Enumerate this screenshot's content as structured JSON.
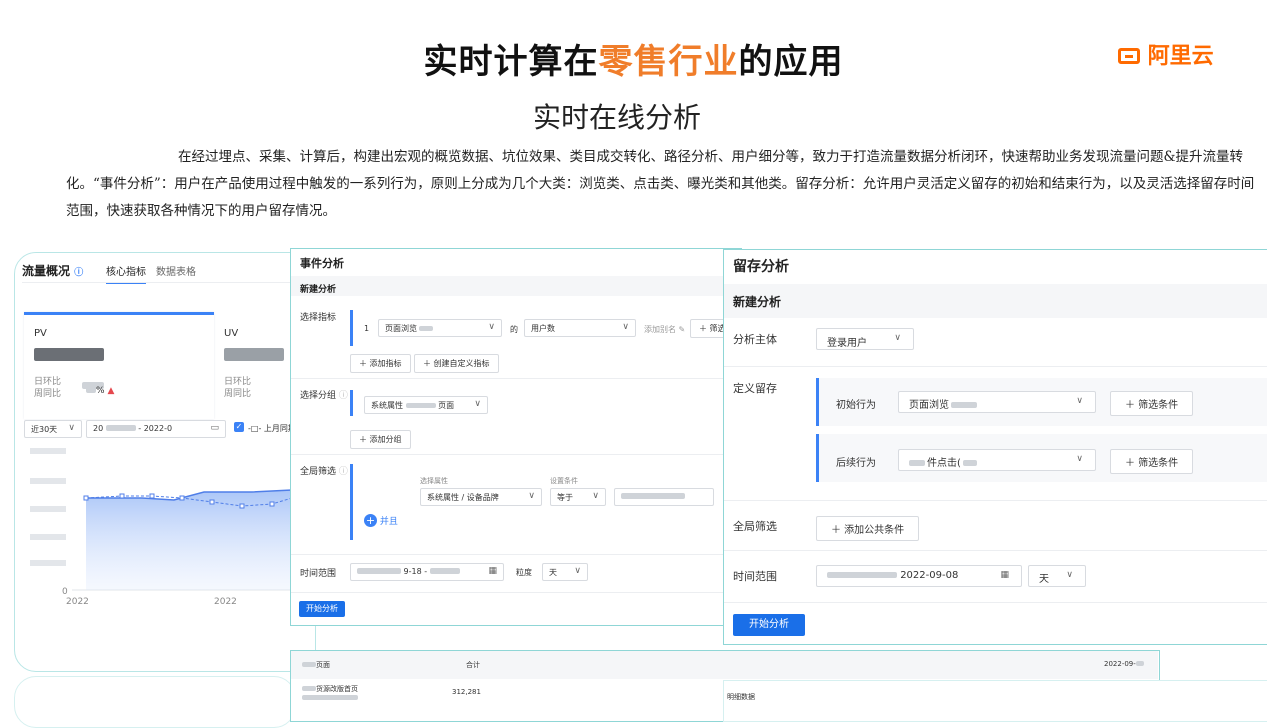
{
  "header": {
    "title_before": "实时计算在",
    "title_highlight": "零售行业",
    "title_after": "的应用",
    "logo_text": "阿里云",
    "subtitle": "实时在线分析",
    "description": "在经过埋点、采集、计算后，构建出宏观的概览数据、坑位效果、类目成交转化、路径分析、用户细分等，致力于打造流量数据分析闭环，快速帮助业务发现流量问题&提升流量转化。“事件分析”：用户在产品使用过程中触发的一系列行为，原则上分成为几个大类：浏览类、点击类、曝光类和其他类。留存分析：允许用户灵活定义留存的初始和结束行为，以及灵活选择留存时间范围，快速获取各种情况下的用户留存情况。"
  },
  "colors": {
    "accent": "#f07d2a",
    "brand": "#ff6a00",
    "primary": "#1a6fe8",
    "border": "#8fd6d6"
  },
  "traffic": {
    "title": "流量概况",
    "tabs": [
      "核心指标",
      "数据表格"
    ],
    "pv_label": "PV",
    "uv_label": "UV",
    "day_ratio": "日环比",
    "week_ratio": "周同比",
    "percent": "%",
    "range": "近30天",
    "date_prefix": "20",
    "date_mid": "- 2022-0",
    "legend": "-□- 上月同期",
    "axis_zero": "0",
    "x_labels": [
      "2022",
      "2022"
    ]
  },
  "event": {
    "title": "事件分析",
    "new": "新建分析",
    "select_metric": "选择指标",
    "index": "1",
    "metric_sel": "页面浏览",
    "of": "的",
    "user_count": "用户数",
    "add_alias": "添加别名",
    "filter": "＋ 筛选",
    "add_metric": "＋ 添加指标",
    "create_custom": "＋ 创建自定义指标",
    "select_group": "选择分组",
    "group_sel": "系统属性",
    "group_page": "页面",
    "add_group": "＋ 添加分组",
    "global_filter": "全局筛选",
    "attr_label": "选择属性",
    "cond_label": "设置条件",
    "attr_sel": "系统属性 / 设备品牌",
    "equals": "等于",
    "and": "并且",
    "time_range": "时间范围",
    "date_part": "9-18 -",
    "granularity": "粒度",
    "day": "天",
    "start": "开始分析"
  },
  "retention": {
    "title": "留存分析",
    "new": "新建分析",
    "subject_label": "分析主体",
    "subject": "登录用户",
    "define": "定义留存",
    "initial_label": "初始行为",
    "initial_sel": "页面浏览",
    "followup_label": "后续行为",
    "followup_sel": "件点击(",
    "filter_cond": "＋  筛选条件",
    "global_filter": "全局筛选",
    "add_public": "＋  添加公共条件",
    "time_range": "时间范围",
    "date_end": "2022-09-08",
    "day": "天",
    "start": "开始分析"
  },
  "table": {
    "col_page": "页面",
    "col_total": "合计",
    "col_date": "2022-09-",
    "row_name": "货源改版首页",
    "row_value": "312,281",
    "detail": "明细数据"
  }
}
